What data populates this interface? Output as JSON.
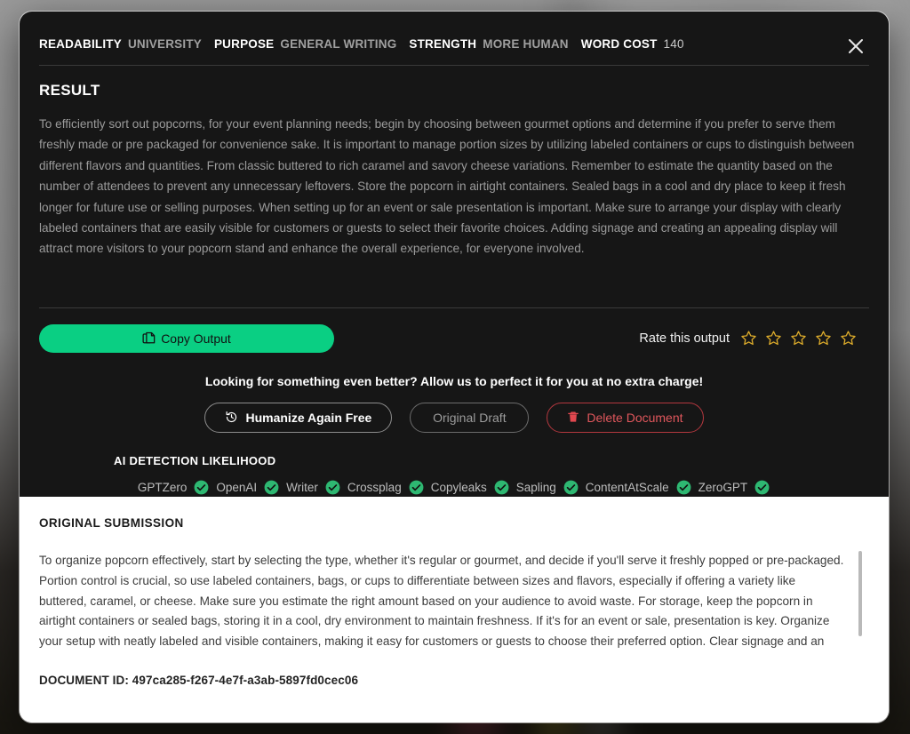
{
  "backdrop": {
    "note": "blurred page behind modal"
  },
  "modal": {
    "close_icon": "close-icon",
    "meta": [
      {
        "key": "READABILITY",
        "value": "UNIVERSITY"
      },
      {
        "key": "PURPOSE",
        "value": "GENERAL WRITING"
      },
      {
        "key": "STRENGTH",
        "value": "MORE HUMAN"
      },
      {
        "key": "WORD COST",
        "value": "140"
      }
    ],
    "result": {
      "title": "RESULT",
      "text": "To efficiently sort out popcorns, for your event planning needs; begin by choosing between gourmet options and determine if you prefer to serve them freshly made or pre packaged for convenience sake. It is important to manage portion sizes by utilizing labeled containers or cups to distinguish between different flavors and quantities. From classic buttered to rich caramel and savory cheese variations. Remember to estimate the quantity based on the number of attendees to prevent any unnecessary leftovers. Store the popcorn in airtight containers. Sealed bags in a cool and dry place to keep it fresh longer for future use or selling purposes. When setting up for an event or sale presentation is important. Make sure to arrange your display with clearly labeled containers that are easily visible for customers or guests to select their favorite choices. Adding signage and creating an appealing display will attract more visitors to your popcorn stand and enhance the overall experience, for everyone involved."
    },
    "actions": {
      "copy_label": "Copy Output",
      "copy_icon": "copy-icon",
      "copy_color": "#0ACF83",
      "rate_label": "Rate this output",
      "star_count": 5,
      "stars_filled": 0,
      "star_color": "#D8A82A"
    },
    "promo": {
      "text": "Looking for something even better? Allow us to perfect it for you at no extra charge!",
      "buttons": [
        {
          "label": "Humanize Again Free",
          "icon": "history-icon",
          "name": "humanize-again-button"
        },
        {
          "label": "Original Draft",
          "icon": "none",
          "name": "original-draft-button"
        },
        {
          "label": "Delete Document",
          "icon": "trash-icon",
          "name": "delete-document-button",
          "color": "#e0575c"
        }
      ]
    },
    "detection": {
      "title": "AI DETECTION LIKELIHOOD",
      "check_color": "#2EB872",
      "detectors": [
        {
          "name": "GPTZero",
          "status": "pass"
        },
        {
          "name": "OpenAI",
          "status": "pass"
        },
        {
          "name": "Writer",
          "status": "pass"
        },
        {
          "name": "Crossplag",
          "status": "pass"
        },
        {
          "name": "Copyleaks",
          "status": "pass"
        },
        {
          "name": "Sapling",
          "status": "pass"
        },
        {
          "name": "ContentAtScale",
          "status": "pass"
        },
        {
          "name": "ZeroGPT",
          "status": "pass"
        }
      ]
    },
    "original": {
      "title": "ORIGINAL SUBMISSION",
      "text": "To organize popcorn effectively, start by selecting the type, whether it's regular or gourmet, and decide if you'll serve it freshly popped or pre-packaged. Portion control is crucial, so use labeled containers, bags, or cups to differentiate between sizes and flavors, especially if offering a variety like buttered, caramel, or cheese. Make sure you estimate the right amount based on your audience to avoid waste. For storage, keep the popcorn in airtight containers or sealed bags, storing it in a cool, dry environment to maintain freshness. If it's for an event or sale, presentation is key. Organize your setup with neatly labeled and visible containers, making it easy for customers or guests to choose their preferred option. Clear signage and an",
      "document_id_label": "DOCUMENT ID: 497ca285-f267-4e7f-a3ab-5897fd0cec06"
    }
  }
}
